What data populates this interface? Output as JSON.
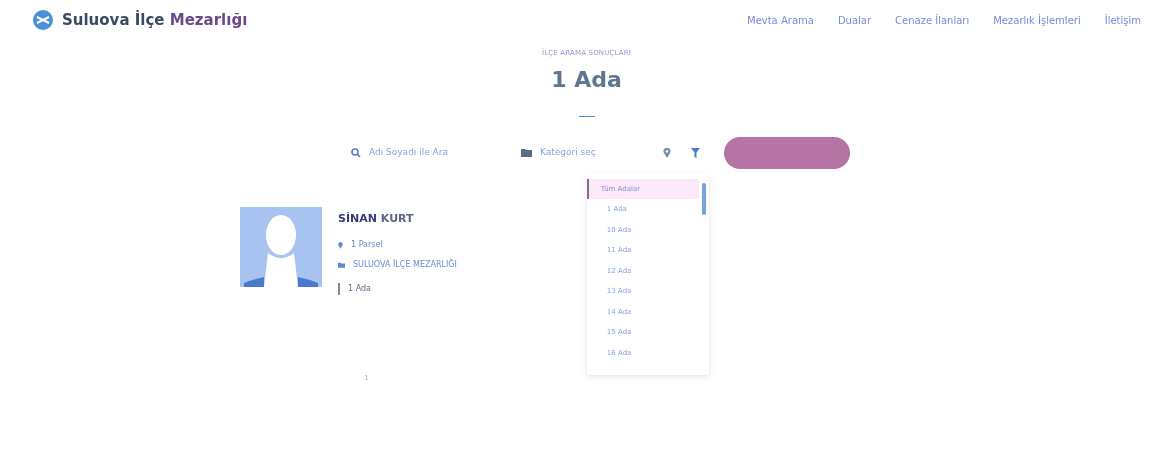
{
  "header": {
    "logo_text": "Suluova İlçe",
    "logo_bold": "Mezarlığı",
    "nav": [
      "Mevta Arama",
      "Dualar",
      "Cenaze İlanları",
      "Mezarlık İşlemleri",
      "İletişim"
    ]
  },
  "page_title": {
    "overline": "İLÇE ARAMA SONUÇLARI",
    "title": "1 Ada"
  },
  "search": {
    "placeholder": "Adı Soyadı ile Ara",
    "category_placeholder": "Kategori seç"
  },
  "dropdown": {
    "items": [
      {
        "label": "Tüm Adalar",
        "selected": true
      },
      {
        "label": "1 Ada",
        "selected": false
      },
      {
        "label": "10 Ada",
        "selected": false
      },
      {
        "label": "11 Ada",
        "selected": false
      },
      {
        "label": "12 Ada",
        "selected": false
      },
      {
        "label": "13 Ada",
        "selected": false
      },
      {
        "label": "14 Ada",
        "selected": false
      },
      {
        "label": "15 Ada",
        "selected": false
      },
      {
        "label": "16 Ada",
        "selected": false
      }
    ]
  },
  "result": {
    "first_name": "SİNAN",
    "last_name": "KURT",
    "parcel": "1 Parsel",
    "cemetery": "SULUOVA İLÇE MEZARLIĞI",
    "block": "1 Ada"
  },
  "pagination": [
    "1"
  ]
}
